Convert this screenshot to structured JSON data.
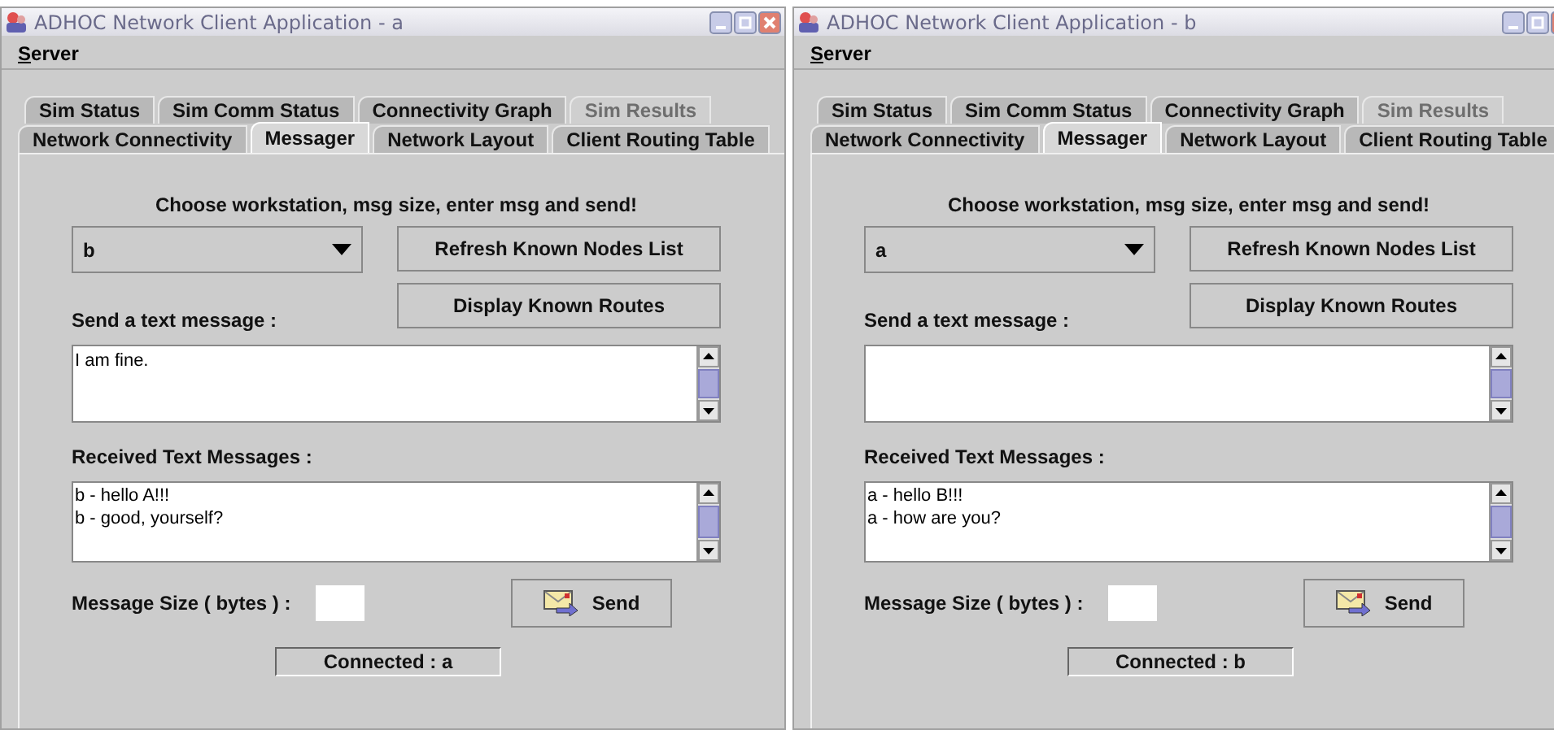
{
  "windows": [
    {
      "title": "ADHOC Network Client Application - a",
      "menu": [
        "Server"
      ],
      "tab_rows": [
        [
          {
            "label": "Sim Status",
            "selected": false,
            "disabled": false
          },
          {
            "label": "Sim Comm Status",
            "selected": false,
            "disabled": false
          },
          {
            "label": "Connectivity Graph",
            "selected": false,
            "disabled": false
          },
          {
            "label": "Sim Results",
            "selected": false,
            "disabled": true
          }
        ],
        [
          {
            "label": "Network Connectivity",
            "selected": false,
            "disabled": false
          },
          {
            "label": "Messager",
            "selected": true,
            "disabled": false
          },
          {
            "label": "Network Layout",
            "selected": false,
            "disabled": false
          },
          {
            "label": "Client Routing Table",
            "selected": false,
            "disabled": false
          }
        ]
      ],
      "instruction": "Choose workstation, msg size, enter msg and send!",
      "workstation": "b",
      "buttons": [
        "Refresh Known Nodes List",
        "Display Known Routes"
      ],
      "send_label": "Send a text message :",
      "message": "I am fine.",
      "received_label": "Received Text Messages :",
      "received": [
        "b - hello A!!!",
        "b - good, yourself?"
      ],
      "size_label": "Message Size ( bytes ) :",
      "send_button": "Send",
      "status": "Connected : a"
    },
    {
      "title": "ADHOC Network Client Application - b",
      "menu": [
        "Server"
      ],
      "tab_rows": [
        [
          {
            "label": "Sim Status",
            "selected": false,
            "disabled": false
          },
          {
            "label": "Sim Comm Status",
            "selected": false,
            "disabled": false
          },
          {
            "label": "Connectivity Graph",
            "selected": false,
            "disabled": false
          },
          {
            "label": "Sim Results",
            "selected": false,
            "disabled": true
          }
        ],
        [
          {
            "label": "Network Connectivity",
            "selected": false,
            "disabled": false
          },
          {
            "label": "Messager",
            "selected": true,
            "disabled": false
          },
          {
            "label": "Network Layout",
            "selected": false,
            "disabled": false
          },
          {
            "label": "Client Routing Table",
            "selected": false,
            "disabled": false
          }
        ]
      ],
      "instruction": "Choose workstation, msg size, enter msg and send!",
      "workstation": "a",
      "buttons": [
        "Refresh Known Nodes List",
        "Display Known Routes"
      ],
      "send_label": "Send a text message :",
      "received_label": "Received Text Messages :",
      "received": [
        "a - hello B!!!",
        "a - how are you?"
      ],
      "size_label": "Message Size ( bytes ) :",
      "send_button": "Send",
      "status": "Connected : b"
    }
  ]
}
